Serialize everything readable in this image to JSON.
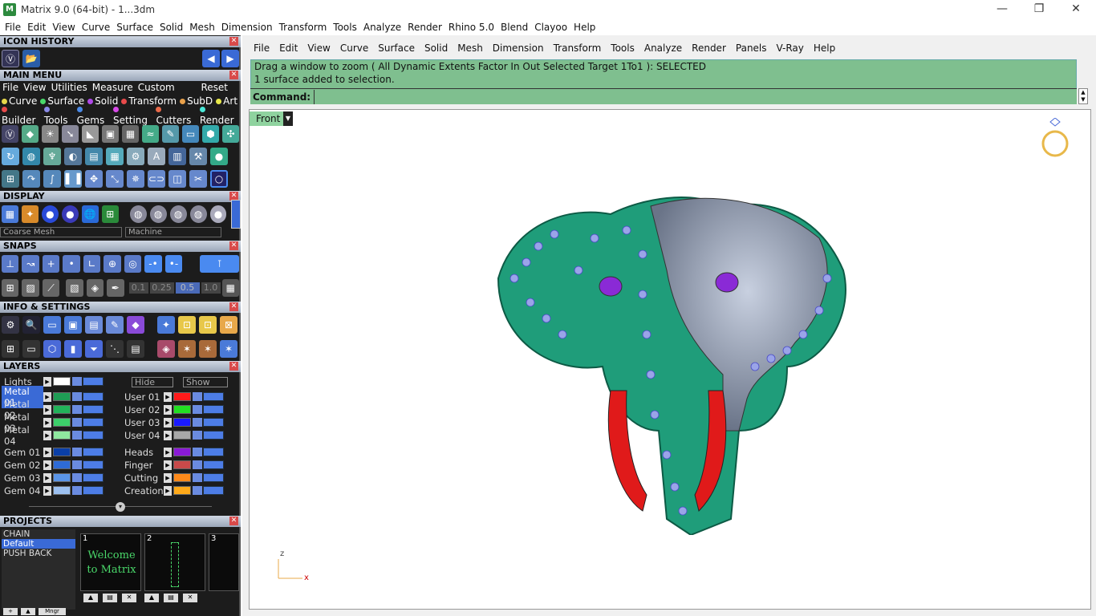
{
  "window": {
    "title": "Matrix 9.0 (64-bit) - 1...3dm",
    "min": "—",
    "restore": "❐",
    "close": "✕"
  },
  "menubar": [
    "File",
    "Edit",
    "View",
    "Curve",
    "Surface",
    "Solid",
    "Mesh",
    "Dimension",
    "Transform",
    "Tools",
    "Analyze",
    "Render",
    "Rhino 5.0",
    "Blend",
    "Clayoo",
    "Help"
  ],
  "panels": {
    "icon_history": "ICON HISTORY",
    "main_menu": "MAIN MENU",
    "display": "DISPLAY",
    "snaps": "SNAPS",
    "info_settings": "INFO & SETTINGS",
    "layers": "LAYERS",
    "projects": "PROJECTS"
  },
  "main_menu_items": [
    "File",
    "View",
    "Utilities",
    "Measure",
    "Custom"
  ],
  "main_menu_reset": "Reset",
  "builder_row1": [
    {
      "label": "Curve",
      "color": "#e8d84a"
    },
    {
      "label": "Surface",
      "color": "#4ad86a"
    },
    {
      "label": "Solid",
      "color": "#b04ae8"
    },
    {
      "label": "Transform",
      "color": "#e84a4a"
    },
    {
      "label": "SubD",
      "color": "#e8a04a"
    },
    {
      "label": "Art",
      "color": "#e8e84a"
    }
  ],
  "builder_row2": [
    {
      "label": "Builder",
      "color": "#e84a4a"
    },
    {
      "label": "Tools",
      "color": "#8a8ae8"
    },
    {
      "label": "Gems",
      "color": "#4a8ae8"
    },
    {
      "label": "Setting",
      "color": "#d84ae8"
    },
    {
      "label": "Cutters",
      "color": "#e86a4a"
    },
    {
      "label": "Render",
      "color": "#4ae8d8"
    }
  ],
  "display": {
    "mesh": "Coarse Mesh",
    "material": "Machine"
  },
  "snaps_values": [
    "0.1",
    "0.25",
    "0.5",
    "1.0"
  ],
  "layers": {
    "lights": "Lights",
    "hide": "Hide",
    "show": "Show",
    "left": [
      {
        "name": "Metal 01",
        "color": "#1f9d55"
      },
      {
        "name": "Metal 02",
        "color": "#22b35a"
      },
      {
        "name": "Metal 03",
        "color": "#3ccf6a"
      },
      {
        "name": "Metal 04",
        "color": "#8fe89f"
      },
      {
        "name": "Gem 01",
        "color": "#0a3fa8"
      },
      {
        "name": "Gem 02",
        "color": "#2e6bd6"
      },
      {
        "name": "Gem 03",
        "color": "#5a95e8"
      },
      {
        "name": "Gem 04",
        "color": "#9cc0f0"
      }
    ],
    "right": [
      {
        "name": "User 01",
        "color": "#ff1a1a"
      },
      {
        "name": "User 02",
        "color": "#22e022"
      },
      {
        "name": "User 03",
        "color": "#1a1aff"
      },
      {
        "name": "User 04",
        "color": "#a8a8a8"
      },
      {
        "name": "Heads",
        "color": "#8a1ad6"
      },
      {
        "name": "Finger",
        "color": "#c84a4a"
      },
      {
        "name": "Cutting",
        "color": "#ff8a1a"
      },
      {
        "name": "Creation",
        "color": "#ffaa1a"
      }
    ]
  },
  "projects": {
    "list": [
      "CHAIN",
      "Default",
      "PUSH BACK"
    ],
    "thumbs": [
      {
        "num": "1",
        "text": "Welcome to Matrix"
      },
      {
        "num": "2",
        "text": ""
      },
      {
        "num": "3",
        "text": ""
      }
    ],
    "mngr": "Mngr"
  },
  "right_menu": [
    "File",
    "Edit",
    "View",
    "Curve",
    "Surface",
    "Solid",
    "Mesh",
    "Dimension",
    "Transform",
    "Tools",
    "Analyze",
    "Render",
    "Panels",
    "V-Ray",
    "Help"
  ],
  "command": {
    "line1": "Drag a window to zoom ( All  Dynamic  Extents  Factor  In  Out  Selected  Target  1To1 ): SELECTED",
    "line2": "1 surface added to selection.",
    "label": "Command:"
  },
  "viewport": {
    "name": "Front",
    "axis_z": "z",
    "axis_x": "x"
  }
}
